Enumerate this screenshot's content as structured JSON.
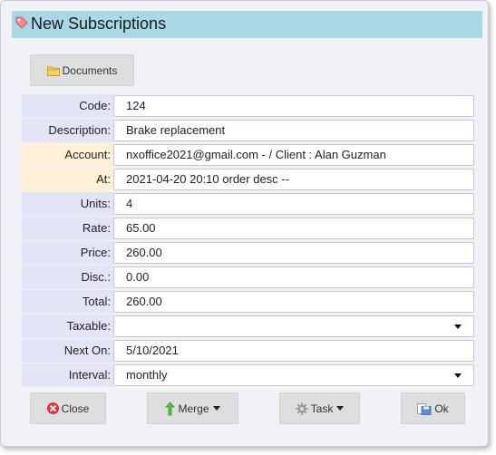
{
  "window": {
    "title": "New Subscriptions",
    "icon": "tag-icon"
  },
  "toolbar": {
    "documents_label": "Documents"
  },
  "form": {
    "rows": [
      {
        "label": "Code:",
        "value": "124"
      },
      {
        "label": "Description:",
        "value": "Brake replacement"
      },
      {
        "label": "Account:",
        "value": "nxoffice2021@gmail.com -  / Client : Alan Guzman"
      },
      {
        "label": "At:",
        "value": "2021-04-20 20:10 order desc --"
      },
      {
        "label": "Units:",
        "value": "4"
      },
      {
        "label": "Rate:",
        "value": "65.00"
      },
      {
        "label": "Price:",
        "value": "260.00"
      },
      {
        "label": "Disc.:",
        "value": "0.00"
      },
      {
        "label": "Total:",
        "value": "260.00"
      },
      {
        "label": "Taxable:",
        "value": ""
      },
      {
        "label": "Next On:",
        "value": "5/10/2021"
      },
      {
        "label": "Interval:",
        "value": "monthly"
      }
    ]
  },
  "footer": {
    "close_label": "Close",
    "merge_label": "Merge",
    "task_label": "Task",
    "ok_label": "Ok"
  },
  "colors": {
    "titlebar": "#a9d8e4",
    "label_bg": "#e3e4f6",
    "label_highlight_bg": "#fdf0d6",
    "button_bg": "#dedede"
  }
}
